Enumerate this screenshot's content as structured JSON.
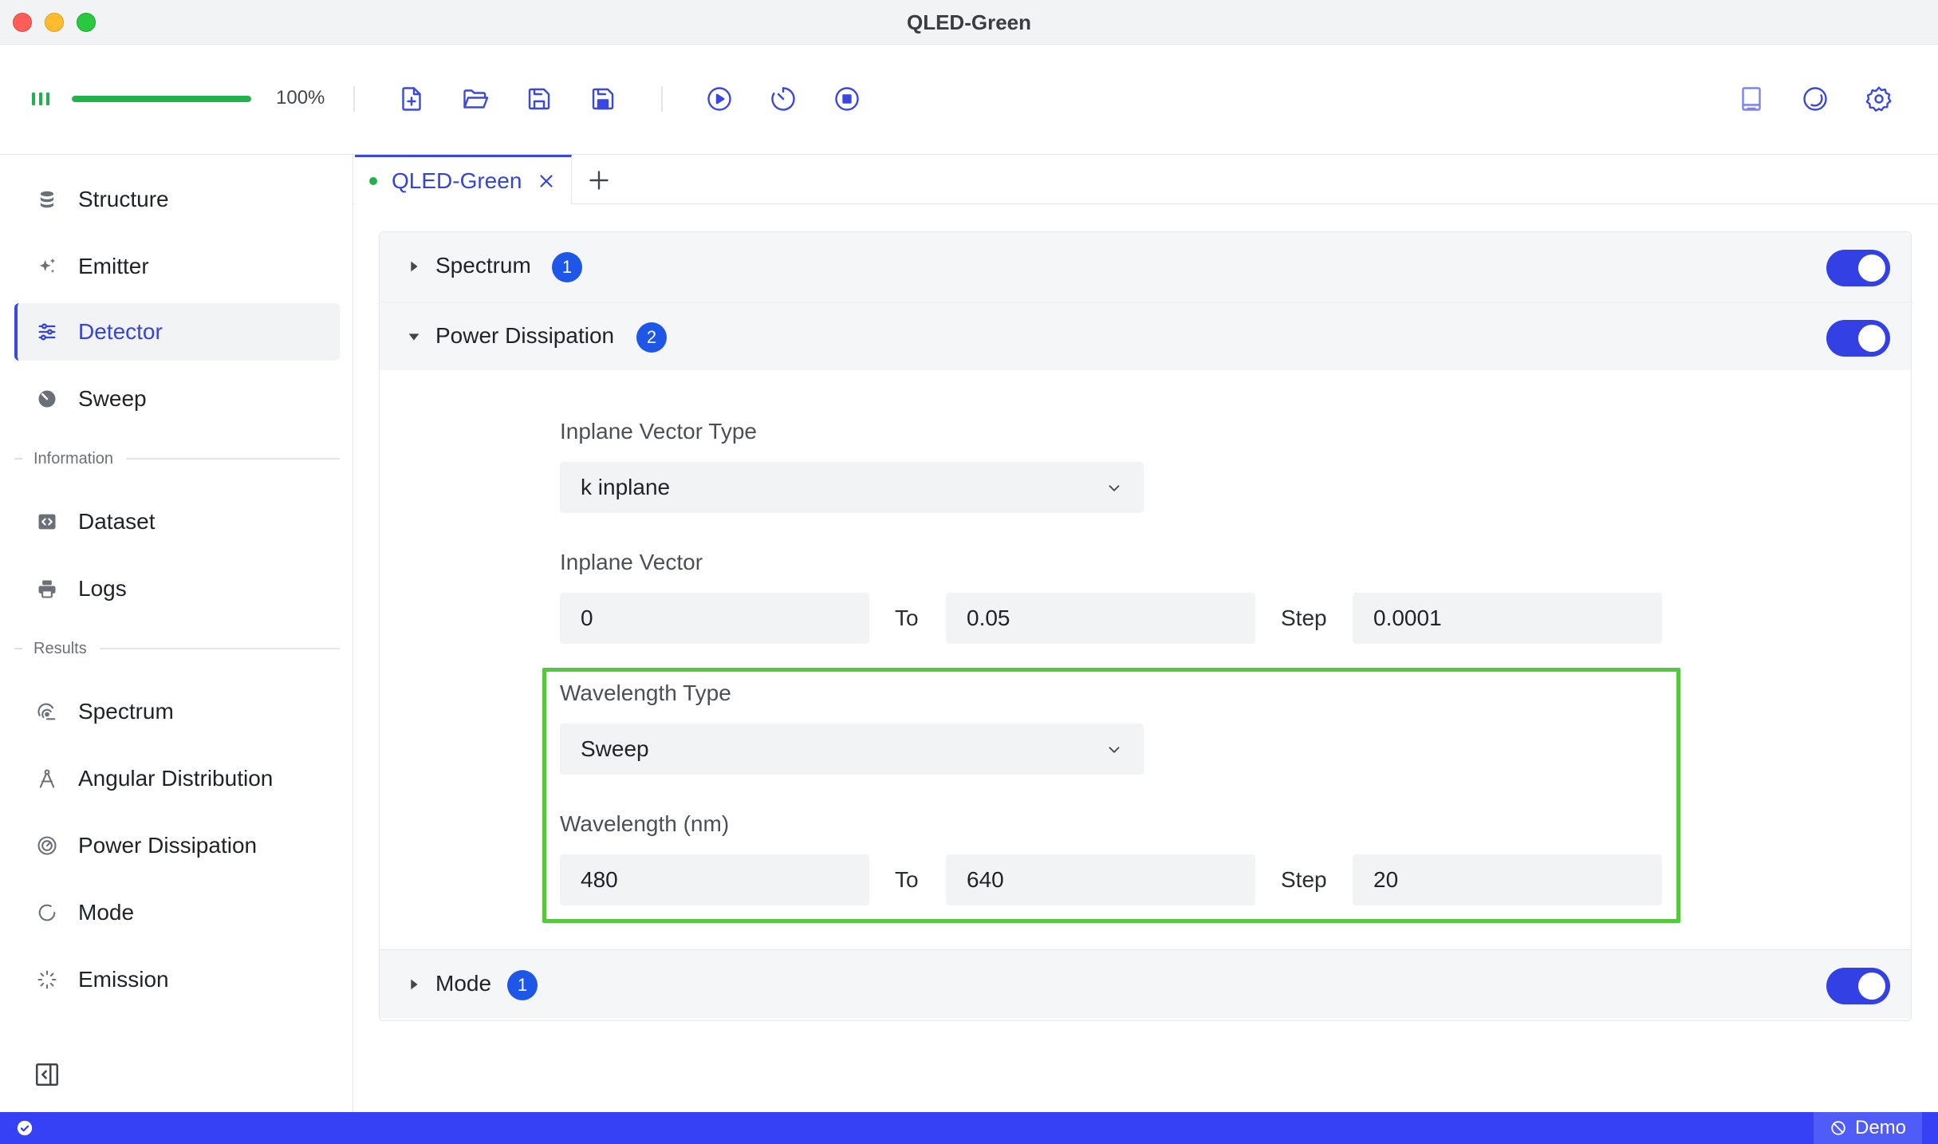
{
  "window": {
    "title": "QLED-Green"
  },
  "toolbar": {
    "progress_fraction": 1.0,
    "progress_text": "100%",
    "icons": [
      "signal-icon",
      "new-file-icon",
      "open-folder-icon",
      "save-icon",
      "save-as-icon",
      "run-icon",
      "timer-icon",
      "stop-icon",
      "book-icon",
      "theme-icon",
      "settings-icon"
    ]
  },
  "sidebar": {
    "items": [
      {
        "label": "Structure",
        "icon": "database-icon"
      },
      {
        "label": "Emitter",
        "icon": "sparkles-icon"
      },
      {
        "label": "Detector",
        "icon": "sliders-icon",
        "active": true
      },
      {
        "label": "Sweep",
        "icon": "sweep-icon"
      }
    ],
    "information_label": "Information",
    "information_items": [
      {
        "label": "Dataset",
        "icon": "code-icon"
      },
      {
        "label": "Logs",
        "icon": "printer-icon"
      }
    ],
    "results_label": "Results",
    "results_items": [
      {
        "label": "Spectrum",
        "icon": "spectrum-icon"
      },
      {
        "label": "Angular Distribution",
        "icon": "compass-icon"
      },
      {
        "label": "Power Dissipation",
        "icon": "gauge-icon"
      },
      {
        "label": "Mode",
        "icon": "circle-dashed-icon"
      },
      {
        "label": "Emission",
        "icon": "loader-icon"
      }
    ]
  },
  "tabs": [
    {
      "label": "QLED-Green",
      "modified": true
    }
  ],
  "sections": {
    "spectrum": {
      "title": "Spectrum",
      "badge": "1",
      "enabled": true,
      "expanded": false
    },
    "power_dissipation": {
      "title": "Power Dissipation",
      "badge": "2",
      "enabled": true,
      "expanded": true,
      "inplane_vector_type_label": "Inplane Vector Type",
      "inplane_vector_type_value": "k inplane",
      "inplane_vector_label": "Inplane Vector",
      "inplane_from": "0",
      "inplane_to_label": "To",
      "inplane_to": "0.05",
      "inplane_step_label": "Step",
      "inplane_step": "0.0001",
      "wavelength_type_label": "Wavelength Type",
      "wavelength_type_value": "Sweep",
      "wavelength_label": "Wavelength (nm)",
      "wavelength_from": "480",
      "wavelength_to_label": "To",
      "wavelength_to": "640",
      "wavelength_step_label": "Step",
      "wavelength_step": "20"
    },
    "mode": {
      "title": "Mode",
      "badge": "1",
      "enabled": true,
      "expanded": false
    }
  },
  "statusbar": {
    "demo_label": "Demo"
  },
  "colors": {
    "accent": "#3641f5",
    "badge": "#1e56e8",
    "success": "#21b24b",
    "highlight": "#57c640"
  }
}
